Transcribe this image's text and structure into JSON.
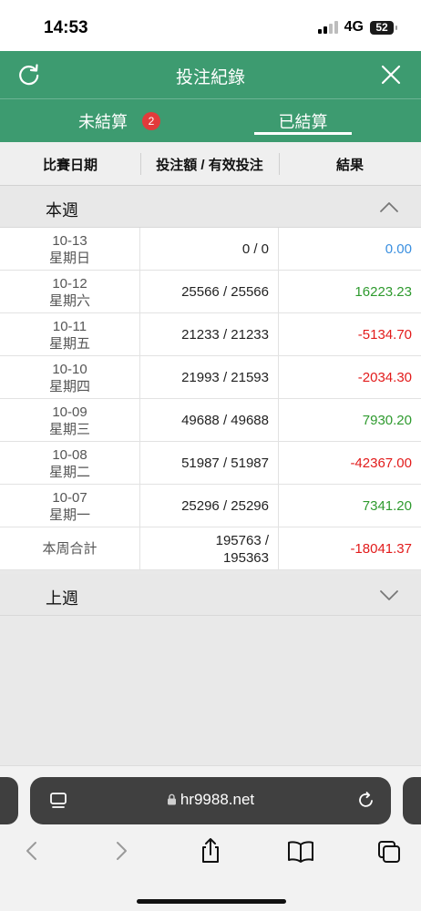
{
  "status": {
    "time": "14:53",
    "network": "4G",
    "battery": "52"
  },
  "header": {
    "title": "投注紀錄"
  },
  "tabs": {
    "unsettled": "未結算",
    "unsettled_badge": "2",
    "settled": "已結算"
  },
  "columns": {
    "date": "比賽日期",
    "bet": "投注額 / 有效投注",
    "result": "結果"
  },
  "this_week": {
    "label": "本週",
    "rows": [
      {
        "date": "10-13",
        "weekday": "星期日",
        "bet": "0 / 0",
        "result": "0.00",
        "sign": "zero"
      },
      {
        "date": "10-12",
        "weekday": "星期六",
        "bet": "25566 / 25566",
        "result": "16223.23",
        "sign": "pos"
      },
      {
        "date": "10-11",
        "weekday": "星期五",
        "bet": "21233 / 21233",
        "result": "-5134.70",
        "sign": "neg"
      },
      {
        "date": "10-10",
        "weekday": "星期四",
        "bet": "21993 / 21593",
        "result": "-2034.30",
        "sign": "neg"
      },
      {
        "date": "10-09",
        "weekday": "星期三",
        "bet": "49688 / 49688",
        "result": "7930.20",
        "sign": "pos"
      },
      {
        "date": "10-08",
        "weekday": "星期二",
        "bet": "51987 / 51987",
        "result": "-42367.00",
        "sign": "neg"
      },
      {
        "date": "10-07",
        "weekday": "星期一",
        "bet": "25296 / 25296",
        "result": "7341.20",
        "sign": "pos"
      }
    ],
    "total": {
      "label": "本周合計",
      "bet_line1": "195763 /",
      "bet_line2": "195363",
      "result": "-18041.37"
    }
  },
  "last_week": {
    "label": "上週"
  },
  "browser": {
    "url": "hr9988.net"
  },
  "colors": {
    "brand_green": "#3d9b70",
    "positive": "#2e9a2e",
    "negative": "#e21b1b",
    "zero": "#3a8fe0",
    "badge": "#e23b3b"
  }
}
